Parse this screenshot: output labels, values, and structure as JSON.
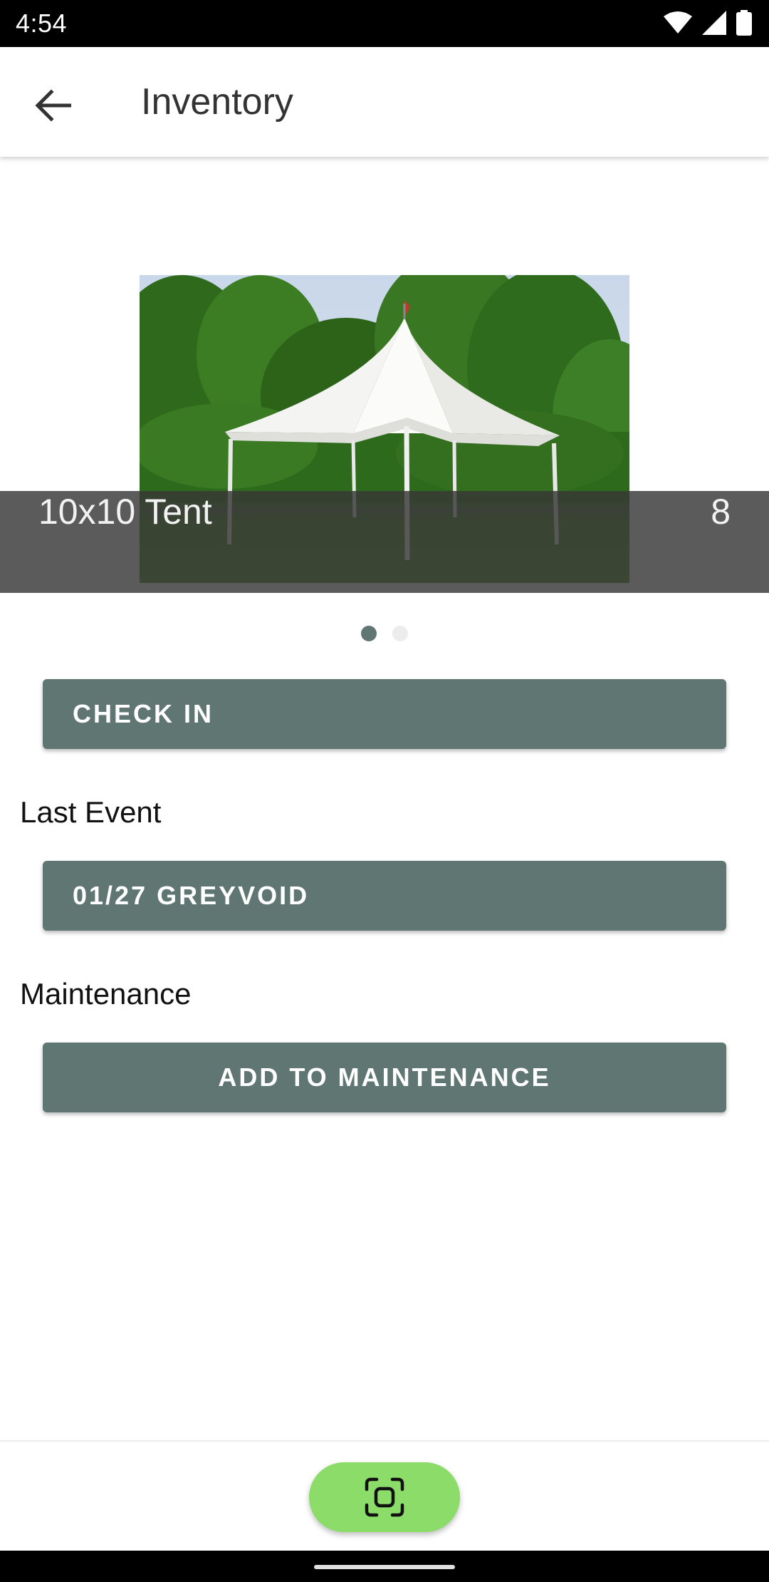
{
  "status_bar": {
    "time": "4:54",
    "icons": [
      "wifi-icon",
      "cellular-signal-icon",
      "battery-icon"
    ]
  },
  "app_bar": {
    "back_icon": "arrow-left-icon",
    "title": "Inventory"
  },
  "carousel": {
    "item_name": "10x10 Tent",
    "item_count": "8",
    "page_count": 2,
    "active_page": 1
  },
  "actions": {
    "check_in_label": "CHECK IN",
    "last_event_heading": "Last Event",
    "last_event_label": "01/27 GREYVOID",
    "maintenance_heading": "Maintenance",
    "add_maintenance_label": "ADD TO MAINTENANCE"
  },
  "fab": {
    "icon": "scan-icon"
  },
  "colors": {
    "primary": "#5f7672",
    "fab": "#8bdc68",
    "overlay": "#373737"
  }
}
